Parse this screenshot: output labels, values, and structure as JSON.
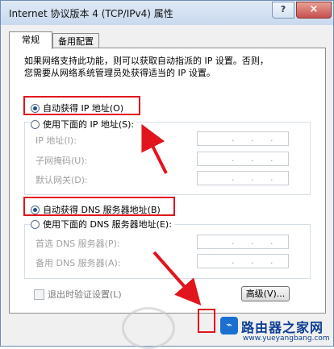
{
  "window": {
    "title": "Internet 协议版本 4 (TCP/IPv4) 属性",
    "help_label": "?",
    "close_label": "×"
  },
  "tabs": [
    {
      "label": "常规",
      "active": true
    },
    {
      "label": "备用配置",
      "active": false
    }
  ],
  "description": [
    "如果网络支持此功能，则可以获取自动指派的 IP 设置。否则，",
    "您需要从网络系统管理员处获得适当的 IP 设置。"
  ],
  "ip": {
    "auto_label": "自动获得 IP 地址(O)",
    "manual_label": "使用下面的 IP 地址(S):",
    "fields": [
      {
        "label": "IP 地址(I):",
        "value": ". . ."
      },
      {
        "label": "子网掩码(U):",
        "value": ". . ."
      },
      {
        "label": "默认网关(D):",
        "value": ". . ."
      }
    ]
  },
  "dns": {
    "auto_label": "自动获得 DNS 服务器地址(B)",
    "manual_label": "使用下面的 DNS 服务器地址(E):",
    "fields": [
      {
        "label": "首选 DNS 服务器(P):",
        "value": ". . ."
      },
      {
        "label": "备用 DNS 服务器(A):",
        "value": ". . ."
      }
    ]
  },
  "validate_label": "退出时验证设置(L)",
  "advanced_label": "高级(V)...",
  "watermark": {
    "text": "路由器之家网",
    "url": "www.yueyangbang.com"
  },
  "colors": {
    "highlight": "#e2141c",
    "titlebar": "#c9d9ee"
  }
}
